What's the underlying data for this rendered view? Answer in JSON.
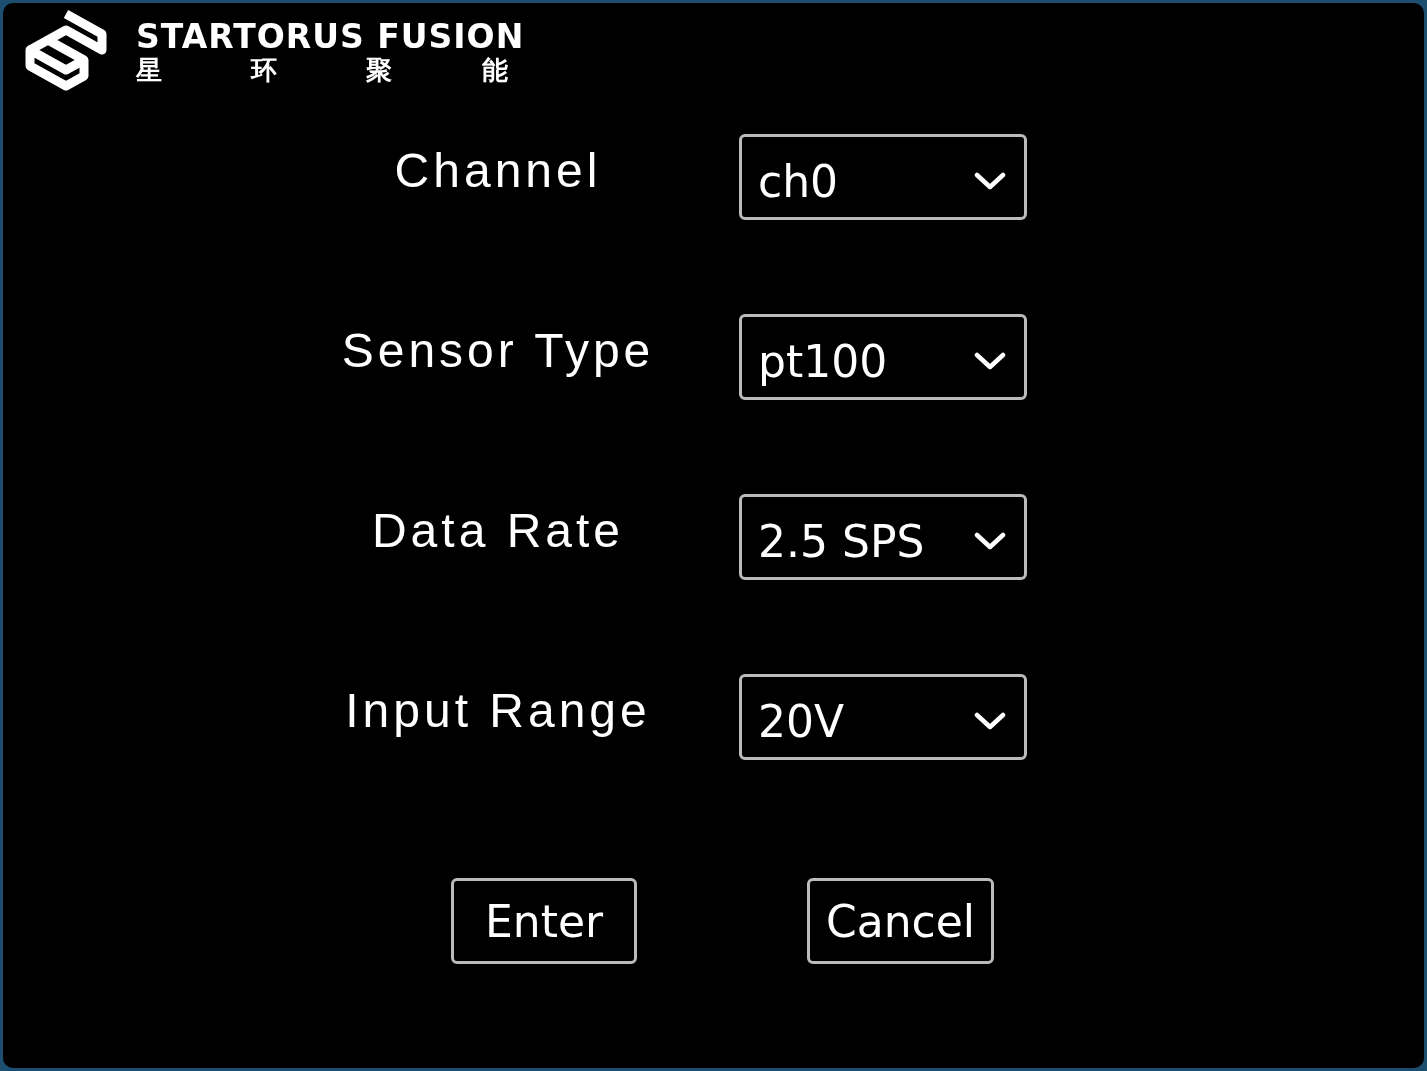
{
  "logo": {
    "title": "STARTORUS FUSION",
    "subtitle": "星 环 聚 能"
  },
  "fields": [
    {
      "label": "Channel",
      "value": "ch0"
    },
    {
      "label": "Sensor Type",
      "value": "pt100"
    },
    {
      "label": "Data Rate",
      "value": "2.5 SPS"
    },
    {
      "label": "Input Range",
      "value": "20V"
    }
  ],
  "buttons": [
    "Enter",
    "Cancel"
  ]
}
